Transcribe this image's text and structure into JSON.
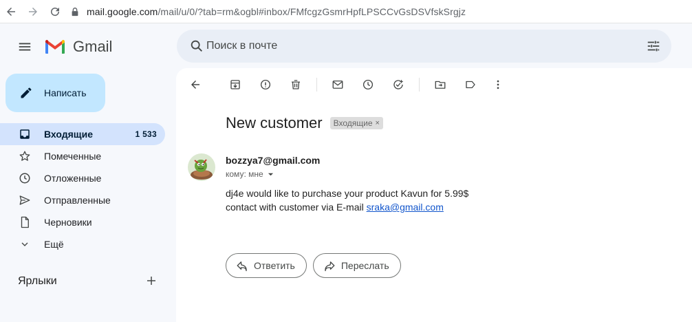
{
  "browser": {
    "url_host": "mail.google.com",
    "url_path": "/mail/u/0/?tab=rm&ogbl#inbox/FMfcgzGsmrHpfLPSCCvGsDSVfskSrgjz"
  },
  "header": {
    "app_name": "Gmail",
    "search_placeholder": "Поиск в почте"
  },
  "sidebar": {
    "compose_label": "Написать",
    "items": [
      {
        "label": "Входящие",
        "count": "1 533",
        "icon": "inbox-icon"
      },
      {
        "label": "Помеченные",
        "icon": "star-icon"
      },
      {
        "label": "Отложенные",
        "icon": "clock-icon"
      },
      {
        "label": "Отправленные",
        "icon": "send-icon"
      },
      {
        "label": "Черновики",
        "icon": "draft-icon"
      },
      {
        "label": "Ещё",
        "icon": "chevron-down-icon"
      }
    ],
    "labels_title": "Ярлыки"
  },
  "message": {
    "subject": "New customer",
    "label_chip": "Входящие",
    "chip_close": "×",
    "sender": "bozzya7@gmail.com",
    "to": "кому: мне",
    "body_line1": "dj4e would like to purchase your product Kavun for 5.99$",
    "body_line2_prefix": "contact with customer via E-mail ",
    "body_link": "sraka@gmail.com"
  },
  "actions": {
    "reply_label": "Ответить",
    "forward_label": "Переслать"
  },
  "colors": {
    "compose_bg": "#c2e7ff",
    "active_nav_bg": "#d3e3fd",
    "search_bg": "#e9eef6",
    "link": "#1155cc"
  }
}
